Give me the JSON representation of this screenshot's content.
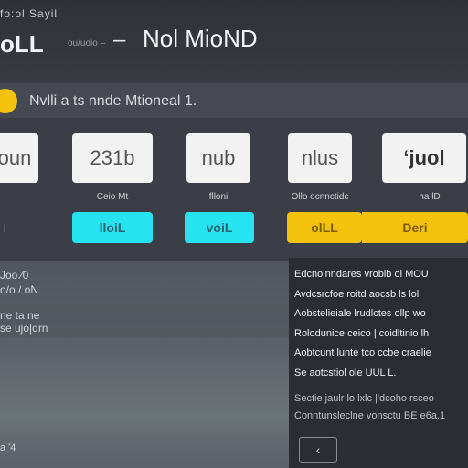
{
  "header": {
    "brand_small": "fo:ol Sayil",
    "brand_main": "oLL",
    "brand_sub": "ou/uoio ‒",
    "dash": "–",
    "title": "Nol MioND"
  },
  "subheader": {
    "text": "Nvlli a ts  nnde  Mtioneal 1."
  },
  "cards": [
    {
      "value": "oun",
      "label": ""
    },
    {
      "value": "231b",
      "label": "Ceio Mt"
    },
    {
      "value": "nub",
      "label": "flloni"
    },
    {
      "value": "nlus",
      "label": "Ollo ocnnctidc"
    },
    {
      "value": "‘juol",
      "label": "ha lD"
    }
  ],
  "buttons": [
    {
      "label": "lloiL"
    },
    {
      "label": "voiL"
    },
    {
      "label": "olLL"
    },
    {
      "label": "Deri"
    }
  ],
  "left_panel": {
    "tick": "l",
    "row1": "Joo  ⁄0",
    "row2": "o/o / oN",
    "row3": "ne  ta ne",
    "row4": "se ujo|drn",
    "footer": "a  ʹ4"
  },
  "right_panel": {
    "lines": [
      "Edcnoinndares  vroblb  ol MOU",
      "Avdcsrcfoe roitd  aocsb  ls  lol",
      "Aobstelieiale lrudlctes  ollp  wo",
      "Rolodunice ceico  |  coidltinio  lh",
      "Aobtcunt  lunte  tco  ccbe  craelie",
      "Se  aotcstiol  ole UUL  L."
    ],
    "footer_lines": [
      "Sectie  jaulr  lo lxlc  |'dcoho  rsceo",
      "Conntunsleclne vonsctu  BE  e6a.1"
    ],
    "back_icon": "‹"
  },
  "colors": {
    "accent_yellow": "#f4c20d",
    "accent_cyan": "#26e4ef",
    "background": "#3b3e46"
  }
}
